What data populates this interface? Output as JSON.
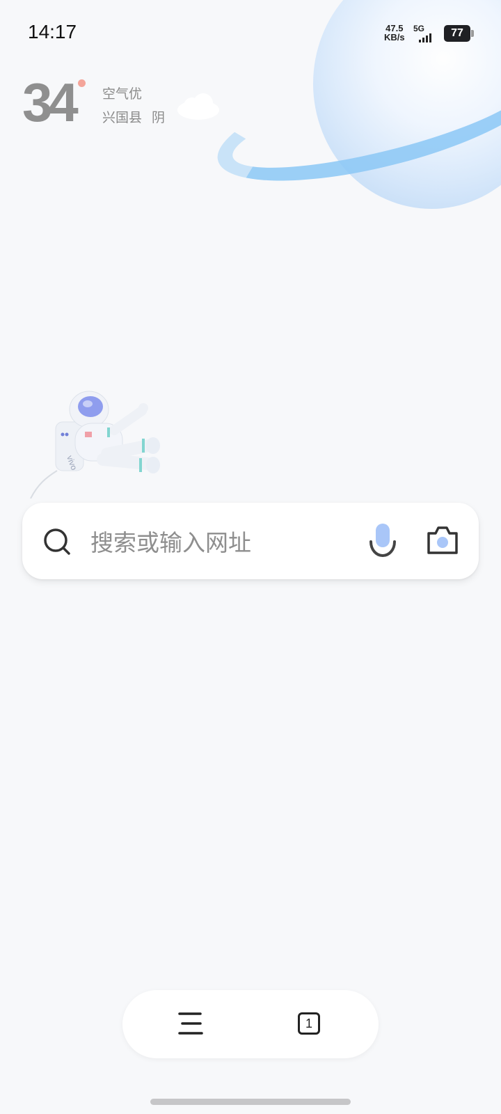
{
  "status_bar": {
    "time": "14:17",
    "network_speed_value": "47.5",
    "network_speed_unit": "KB/s",
    "network_type": "5G",
    "battery_level": "77"
  },
  "weather": {
    "temperature": "34",
    "air_quality": "空气优",
    "location": "兴国县",
    "condition": "阴",
    "condition_icon": "cloud-icon"
  },
  "search": {
    "placeholder": "搜索或输入网址",
    "search_icon": "search-icon",
    "voice_icon": "microphone-icon",
    "camera_icon": "camera-icon"
  },
  "toolbar": {
    "menu_icon": "menu-icon",
    "tab_count": "1"
  },
  "colors": {
    "background": "#f7f8fa",
    "accent_blue": "#8cc8f6",
    "mic_blue": "#a9c6f8",
    "temp_dot": "#f4a59a"
  }
}
